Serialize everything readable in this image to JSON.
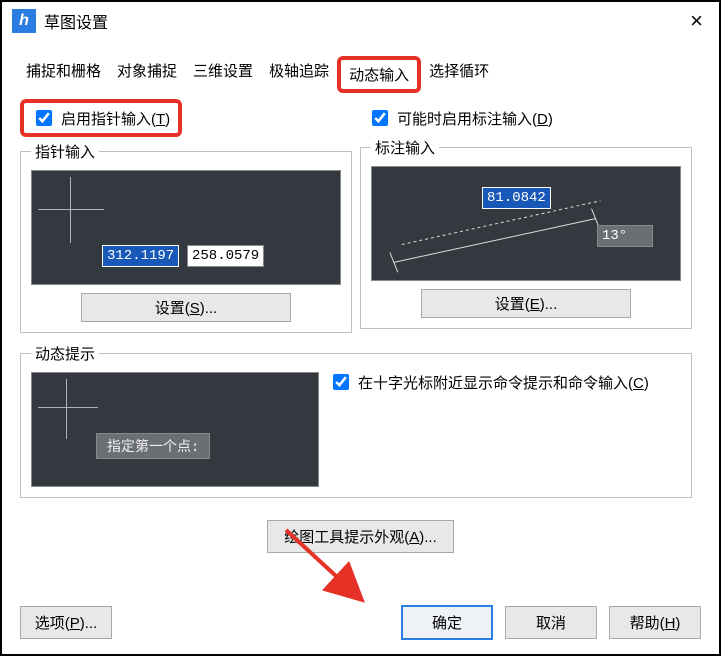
{
  "window": {
    "title": "草图设置"
  },
  "tabs": {
    "t0": "捕捉和栅格",
    "t1": "对象捕捉",
    "t2": "三维设置",
    "t3": "极轴追踪",
    "t4": "动态输入",
    "t5": "选择循环"
  },
  "pointer": {
    "enable_label_pre": "启用指针输入(",
    "enable_key": "T",
    "enable_label_post": ")",
    "legend": "指针输入",
    "val1": "312.1197",
    "val2": "258.0579",
    "settings_pre": "设置(",
    "settings_key": "S",
    "settings_post": ")..."
  },
  "dimension": {
    "enable_label_pre": "可能时启用标注输入(",
    "enable_key": "D",
    "enable_label_post": ")",
    "legend": "标注输入",
    "len": "81.0842",
    "ang": "13°",
    "settings_pre": "设置(",
    "settings_key": "E",
    "settings_post": ")..."
  },
  "dynamic": {
    "legend": "动态提示",
    "prompt": "指定第一个点:",
    "cb_pre": "在十字光标附近显示命令提示和命令输入(",
    "cb_key": "C",
    "cb_post": ")"
  },
  "appearance": {
    "pre": "绘图工具提示外观(",
    "key": "A",
    "post": ")..."
  },
  "footer": {
    "options_pre": "选项(",
    "options_key": "P",
    "options_post": ")...",
    "ok": "确定",
    "cancel": "取消",
    "help_pre": "帮助(",
    "help_key": "H",
    "help_post": ")"
  }
}
